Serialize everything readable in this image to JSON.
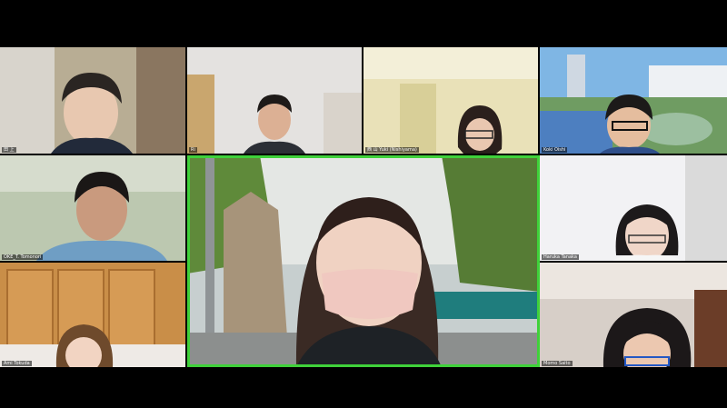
{
  "meeting": {
    "layout": "gallery",
    "active_speaker_border_color": "#3fd13a"
  },
  "participants": [
    {
      "name": "田 上",
      "avatar_icon": "participant-video"
    },
    {
      "name": "Ri",
      "avatar_icon": "participant-video"
    },
    {
      "name": "西 山 Yuki (Nishiyama)",
      "avatar_icon": "participant-video"
    },
    {
      "name": "Koki Oishi",
      "avatar_icon": "participant-video"
    },
    {
      "name": "OKE_T. Tomonori",
      "avatar_icon": "participant-video"
    },
    {
      "name": "",
      "avatar_icon": "participant-video",
      "active_speaker": true
    },
    {
      "name": "Haruka Tanaka",
      "avatar_icon": "participant-video"
    },
    {
      "name": "Ami Tokuda",
      "avatar_icon": "participant-video"
    },
    {
      "name": "Momo Saito",
      "avatar_icon": "participant-video"
    }
  ]
}
